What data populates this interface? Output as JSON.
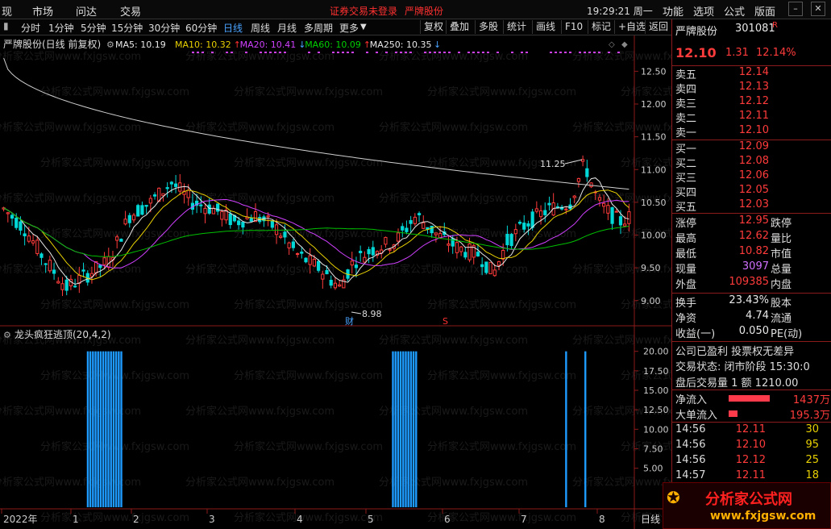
{
  "menu": {
    "items": [
      "现",
      "市场",
      "问达",
      "交易"
    ],
    "notice": "证券交易未登录",
    "notice_stock": "严牌股份",
    "clock": "19:29:21 周一",
    "right_items": [
      "功能",
      "选项",
      "公式",
      "版面"
    ]
  },
  "toolbar": {
    "periods": [
      "分时",
      "1分钟",
      "5分钟",
      "15分钟",
      "30分钟",
      "60分钟",
      "日线",
      "周线",
      "月线",
      "多周期",
      "更多"
    ],
    "active_period": "日线",
    "actions": [
      "复权",
      "叠加",
      "多股",
      "统计",
      "画线",
      "F10",
      "标记",
      "+自选",
      "返回"
    ]
  },
  "chart": {
    "title": "严牌股份(日线 前复权)",
    "ma": [
      {
        "label": "MA5: 10.19",
        "color": "#e8e8e8",
        "arrow": ""
      },
      {
        "label": "MA10: 10.32",
        "color": "#e8d000",
        "arrow": "↑"
      },
      {
        "label": "MA20: 10.41",
        "color": "#d040ff",
        "arrow": "↓"
      },
      {
        "label": "MA60: 10.09",
        "color": "#00d000",
        "arrow": "↑"
      },
      {
        "label": "MA250: 10.35",
        "color": "#e8e8e8",
        "arrow": "↓"
      }
    ],
    "price_axis": [
      "12.50",
      "12.00",
      "11.50",
      "11.00",
      "10.50",
      "10.00",
      "9.50",
      "9.00"
    ],
    "high_label": "11.25",
    "low_label": "8.98",
    "marker_cai": "财",
    "marker_s": "S",
    "indicator_title": "龙头疯狂逃顶(20,4,2)",
    "indicator_axis": [
      "20.00",
      "17.50",
      "15.00",
      "12.50",
      "10.00",
      "7.50",
      "5.00"
    ],
    "time_axis": [
      "2022年",
      "1",
      "2",
      "3",
      "4",
      "5",
      "6",
      "7",
      "8"
    ],
    "period_tag": "日线",
    "watermark": "分析家公式网www.fxjgsw.com"
  },
  "chart_data": {
    "type": "bar",
    "title": "龙头疯狂逃顶(20,4,2)",
    "series": [
      {
        "name": "龙头疯狂逃顶",
        "x_ranges": [
          [
            "2022-02-01",
            "2022-02-14"
          ],
          [
            "2022-05-23",
            "2022-06-01"
          ],
          [
            "2022-07-25",
            "2022-07-25"
          ],
          [
            "2022-08-01",
            "2022-08-01"
          ]
        ],
        "value": 20
      }
    ],
    "ylim": [
      0,
      21
    ]
  },
  "quote": {
    "name": "严牌股份",
    "code": "301081",
    "flag": "R",
    "price": "12.10",
    "change": "1.31",
    "pct": "12.14%",
    "asks": [
      {
        "label": "卖五",
        "price": "12.14"
      },
      {
        "label": "卖四",
        "price": "12.13"
      },
      {
        "label": "卖三",
        "price": "12.12"
      },
      {
        "label": "卖二",
        "price": "12.11"
      },
      {
        "label": "卖一",
        "price": "12.10"
      }
    ],
    "bids": [
      {
        "label": "买一",
        "price": "12.09"
      },
      {
        "label": "买二",
        "price": "12.08"
      },
      {
        "label": "买三",
        "price": "12.06"
      },
      {
        "label": "买四",
        "price": "12.05"
      },
      {
        "label": "买五",
        "price": "12.03"
      }
    ],
    "stats": [
      {
        "l1": "涨停",
        "v1": "12.95",
        "c1": "red",
        "l2": "跌停"
      },
      {
        "l1": "最高",
        "v1": "12.62",
        "c1": "red",
        "l2": "量比"
      },
      {
        "l1": "最低",
        "v1": "10.82",
        "c1": "red",
        "l2": "市值"
      },
      {
        "l1": "现量",
        "v1": "3097",
        "c1": "purple",
        "l2": "总量"
      },
      {
        "l1": "外盘",
        "v1": "109385",
        "c1": "red",
        "l2": "内盘"
      }
    ],
    "stats2": [
      {
        "l1": "换手",
        "v1": "23.43%",
        "c1": "white",
        "l2": "股本"
      },
      {
        "l1": "净资",
        "v1": "4.74",
        "c1": "white",
        "l2": "流通"
      },
      {
        "l1": "收益(一)",
        "v1": "0.050",
        "c1": "white",
        "l2": "PE(动)"
      }
    ],
    "info1": "公司已盈利 投票权无差异",
    "info2": "交易状态: 闭市阶段 15:30:0",
    "info3": "盘后交易量 1 额 1210.00",
    "flow": [
      {
        "label": "净流入",
        "value": "1437万",
        "frac": 0.85
      },
      {
        "label": "大单流入",
        "value": "195.3万",
        "frac": 0.18
      }
    ],
    "ticks": [
      {
        "time": "14:56",
        "price": "12.11",
        "vol": "30"
      },
      {
        "time": "14:56",
        "price": "12.10",
        "vol": "95"
      },
      {
        "time": "14:56",
        "price": "12.12",
        "vol": "25"
      },
      {
        "time": "14:57",
        "price": "12.11",
        "vol": "18"
      }
    ]
  },
  "logo": {
    "text": "分析家公式网",
    "url": "www.fxjgsw.com"
  }
}
